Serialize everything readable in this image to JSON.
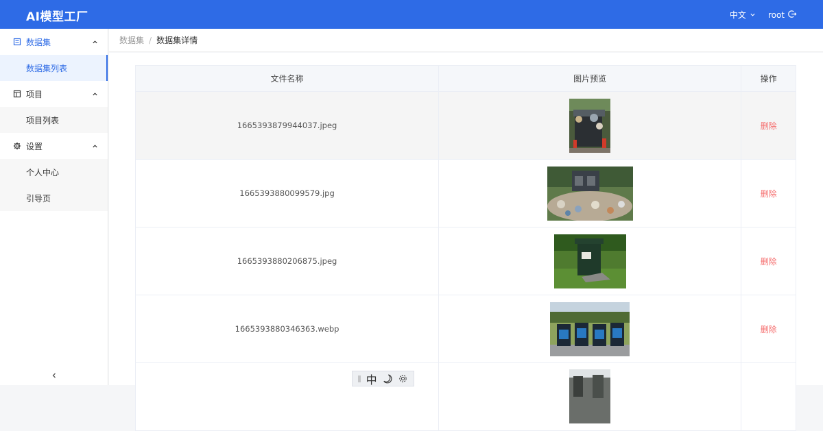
{
  "app": {
    "title": "AI模型工厂"
  },
  "header": {
    "language": "中文",
    "username": "root"
  },
  "sidebar": {
    "groups": [
      {
        "label": "数据集",
        "icon": "list-icon",
        "expanded": true,
        "items": [
          {
            "label": "数据集列表",
            "active": true
          }
        ]
      },
      {
        "label": "项目",
        "icon": "project-icon",
        "expanded": true,
        "items": [
          {
            "label": "项目列表",
            "active": false
          }
        ]
      },
      {
        "label": "设置",
        "icon": "gear-icon",
        "expanded": true,
        "items": [
          {
            "label": "个人中心",
            "active": false
          },
          {
            "label": "引导页",
            "active": false
          }
        ]
      }
    ],
    "collapse_label": "<"
  },
  "breadcrumb": {
    "parent": "数据集",
    "separator": "/",
    "current": "数据集详情"
  },
  "table": {
    "headers": {
      "name": "文件名称",
      "preview": "图片预览",
      "action": "操作"
    },
    "rows": [
      {
        "name": "1665393879944037.jpeg",
        "action": "删除",
        "preview": "overflowing-trash-bin"
      },
      {
        "name": "1665393880099579.jpg",
        "action": "删除",
        "preview": "garbage-pile"
      },
      {
        "name": "1665393880206875.jpeg",
        "action": "删除",
        "preview": "green-bin-on-grass"
      },
      {
        "name": "1665393880346363.webp",
        "action": "删除",
        "preview": "four-sorting-bins"
      },
      {
        "name": "",
        "action": "",
        "preview": "partial-image"
      }
    ]
  },
  "floating_toolbar": {
    "ime_label": "中"
  },
  "colors": {
    "primary": "#2e6be6",
    "danger": "#f56c6c"
  }
}
